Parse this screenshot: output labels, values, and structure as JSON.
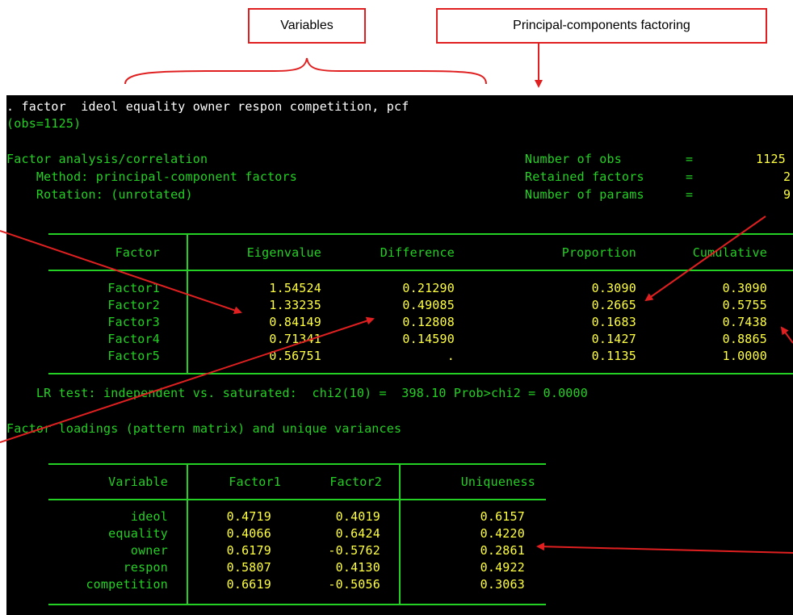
{
  "callouts": {
    "variables": "Variables",
    "pcf": "Principal-components factoring"
  },
  "console": {
    "command": ". factor  ideol equality owner respon competition, pcf",
    "obs": "(obs=1125)",
    "title": "Factor analysis/correlation",
    "method": "    Method: principal-component factors",
    "rotation": "    Rotation: (unrotated)",
    "stats": [
      {
        "label": "Number of obs",
        "eq": "=",
        "value": "1125"
      },
      {
        "label": "Retained factors",
        "eq": "=",
        "value": "2"
      },
      {
        "label": "Number of params",
        "eq": "=",
        "value": "9"
      }
    ],
    "factor_table": {
      "headers": [
        "Factor",
        "Eigenvalue",
        "Difference",
        "Proportion",
        "Cumulative"
      ],
      "rows": [
        [
          "Factor1",
          "1.54524",
          "0.21290",
          "0.3090",
          "0.3090"
        ],
        [
          "Factor2",
          "1.33235",
          "0.49085",
          "0.2665",
          "0.5755"
        ],
        [
          "Factor3",
          "0.84149",
          "0.12808",
          "0.1683",
          "0.7438"
        ],
        [
          "Factor4",
          "0.71341",
          "0.14590",
          "0.1427",
          "0.8865"
        ],
        [
          "Factor5",
          "0.56751",
          ".",
          "0.1135",
          "1.0000"
        ]
      ]
    },
    "lr_test": "    LR test: independent vs. saturated:  chi2(10) =  398.10 Prob>chi2 = 0.0000",
    "loadings_title": "Factor loadings (pattern matrix) and unique variances",
    "loadings_table": {
      "headers": [
        "Variable",
        "Factor1",
        "Factor2",
        "Uniqueness"
      ],
      "rows": [
        [
          "ideol",
          "0.4719",
          "0.4019",
          "0.6157"
        ],
        [
          "equality",
          "0.4066",
          "0.6424",
          "0.4220"
        ],
        [
          "owner",
          "0.6179",
          "-0.5762",
          "0.2861"
        ],
        [
          "respon",
          "0.5807",
          "0.4130",
          "0.4922"
        ],
        [
          "competition",
          "0.6619",
          "-0.5056",
          "0.3063"
        ]
      ]
    }
  },
  "colors": {
    "console_bg": "#000000",
    "console_text": "#23d023",
    "annotation": "#e02020"
  }
}
